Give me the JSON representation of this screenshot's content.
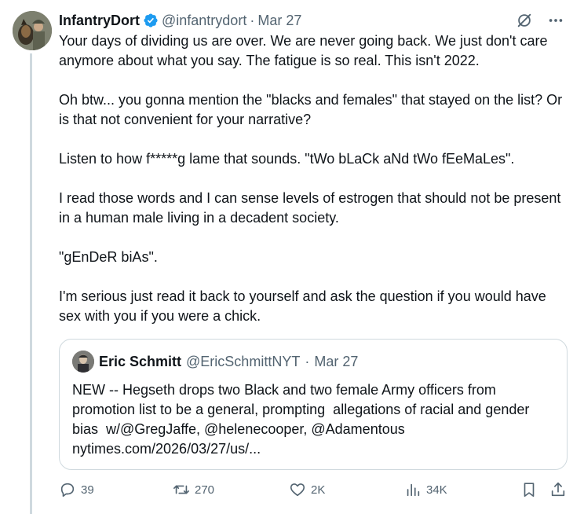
{
  "tweet": {
    "display_name": "InfantryDort",
    "handle": "@infantrydort",
    "separator": "·",
    "date": "Mar 27",
    "verified": true,
    "paragraphs": [
      "Your days of dividing us are over. We are never going back. We just don't care anymore about what you say. The fatigue is so real. This isn't 2022.",
      "Oh btw... you gonna mention the \"blacks and females\" that stayed on the list? Or is that not convenient for your narrative?",
      "Listen to how f*****g lame that sounds. \"tWo bLaCk aNd tWo fEeMaLes\".",
      "I read those words and I can sense levels of estrogen that should not be present in a human male living in a decadent society.",
      "\"gEnDeR biAs\".",
      "I'm serious just read it back to yourself and ask the question if you would have sex with you if you were a chick."
    ]
  },
  "quote": {
    "display_name": "Eric Schmitt",
    "handle": "@EricSchmittNYT",
    "separator": "·",
    "date": "Mar 27",
    "text": "NEW -- Hegseth drops two Black and two female Army officers from promotion list to be a general, prompting  allegations of racial and gender bias  w/@GregJaffe, @helenecooper, @Adamentous\nnytimes.com/2026/03/27/us/..."
  },
  "actions": {
    "replies": "39",
    "reposts": "270",
    "likes": "2K",
    "views": "34K"
  },
  "icons": {
    "verified": "verified-badge-icon",
    "grok": "grok-icon",
    "more": "more-options-icon",
    "reply": "reply-icon",
    "repost": "repost-icon",
    "like": "heart-icon",
    "views": "views-icon",
    "bookmark": "bookmark-icon",
    "share": "share-icon"
  },
  "colors": {
    "text": "#0f1419",
    "muted": "#536471",
    "verified": "#1d9bf0",
    "border": "#cfd9de"
  }
}
